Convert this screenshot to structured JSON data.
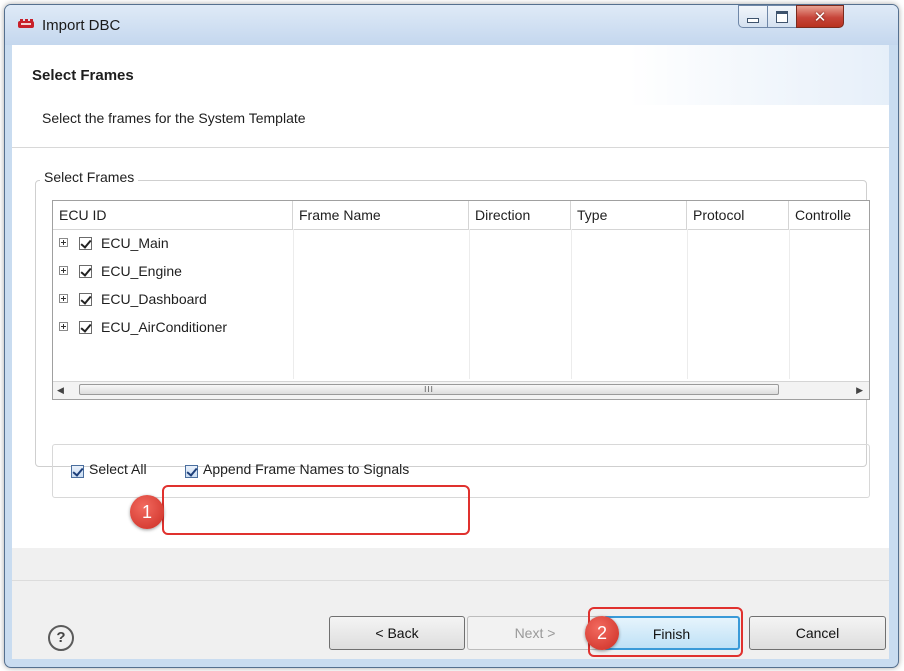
{
  "window": {
    "title": "Import DBC"
  },
  "header": {
    "title": "Select Frames",
    "subtitle": "Select the frames for the System Template"
  },
  "group": {
    "label": "Select Frames"
  },
  "table": {
    "columns": [
      "ECU ID",
      "Frame Name",
      "Direction",
      "Type",
      "Protocol",
      "Controlle"
    ],
    "rows": [
      {
        "label": "ECU_Main",
        "checked": true
      },
      {
        "label": "ECU_Engine",
        "checked": true
      },
      {
        "label": "ECU_Dashboard",
        "checked": true
      },
      {
        "label": "ECU_AirConditioner",
        "checked": true
      }
    ],
    "scroll_thumb_text": "III"
  },
  "options": {
    "select_all": "Select All",
    "append_frame_names": "Append Frame Names to Signals"
  },
  "annotations": {
    "badge1": "1",
    "badge2": "2",
    "highlight_color": "#e0312e"
  },
  "buttons": {
    "back": "< Back",
    "next": "Next >",
    "finish": "Finish",
    "cancel": "Cancel",
    "help": "?"
  }
}
